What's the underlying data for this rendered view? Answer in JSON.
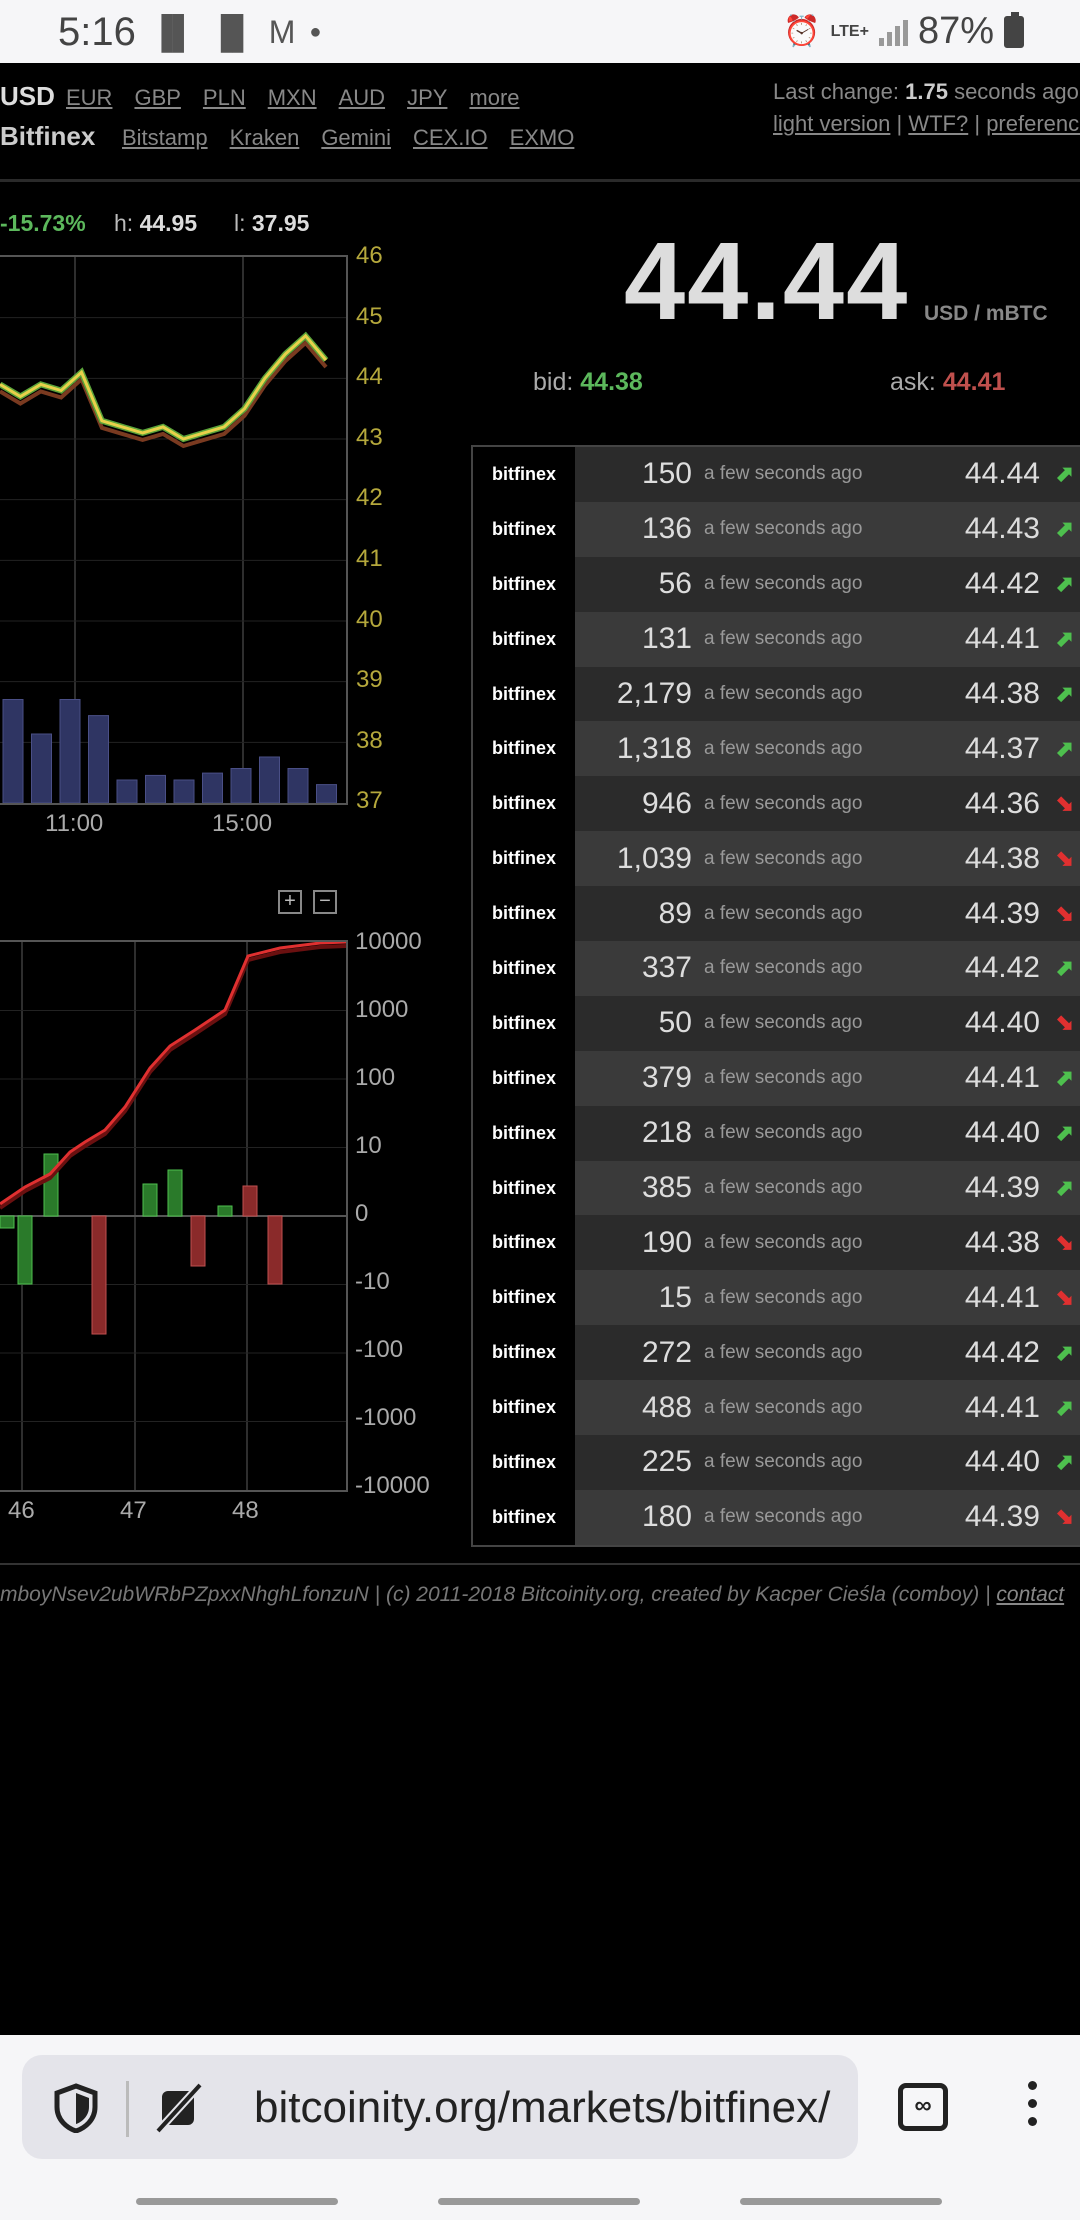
{
  "status_bar": {
    "time": "5:16",
    "network": "LTE+",
    "battery": "87%"
  },
  "header": {
    "active_currency": "USD",
    "currencies": [
      "EUR",
      "GBP",
      "PLN",
      "MXN",
      "AUD",
      "JPY",
      "more"
    ],
    "active_exchange": "Bitfinex",
    "exchanges": [
      "Bitstamp",
      "Kraken",
      "Gemini",
      "CEX.IO",
      "EXMO"
    ],
    "last_change_prefix": "Last change:",
    "last_change_value": "1.75",
    "last_change_suffix": "seconds ago",
    "links": [
      "light version",
      "WTF?",
      "preferences"
    ]
  },
  "stats": {
    "change": "-15.73%",
    "high_label": "h:",
    "high": "44.95",
    "low_label": "l:",
    "low": "37.95"
  },
  "price": {
    "value": "44.44",
    "unit": "USD / mBTC",
    "bid_label": "bid:",
    "bid": "44.38",
    "ask_label": "ask:",
    "ask": "44.41"
  },
  "chart_data": [
    {
      "type": "line",
      "y_ticks": [
        "46",
        "45",
        "44",
        "43",
        "42",
        "41",
        "40",
        "39",
        "38",
        "37"
      ],
      "x_ticks": [
        "11:00",
        "15:00"
      ],
      "ylim": [
        37,
        46
      ],
      "series": [
        {
          "values": [
            43.9,
            43.7,
            43.9,
            43.8,
            44.1,
            43.3,
            43.2,
            43.1,
            43.2,
            43.0,
            43.1,
            43.2,
            43.5,
            44.0,
            44.4,
            44.7,
            44.3
          ]
        }
      ],
      "volume": [
        0.45,
        0.3,
        0.45,
        0.38,
        0.1,
        0.12,
        0.1,
        0.13,
        0.15,
        0.2,
        0.15,
        0.08
      ]
    },
    {
      "type": "line",
      "y_ticks": [
        "10000",
        "1000",
        "100",
        "10",
        "0",
        "-10",
        "-100",
        "-1000",
        "-10000"
      ],
      "x_ticks": [
        "46",
        "47",
        "48"
      ],
      "scale": "symlog"
    }
  ],
  "zoom": {
    "in": "+",
    "out": "−"
  },
  "trades": [
    {
      "exchange": "bitfinex",
      "amount": "150",
      "ago": "a few seconds ago",
      "price": "44.44",
      "dir": "up"
    },
    {
      "exchange": "bitfinex",
      "amount": "136",
      "ago": "a few seconds ago",
      "price": "44.43",
      "dir": "up"
    },
    {
      "exchange": "bitfinex",
      "amount": "56",
      "ago": "a few seconds ago",
      "price": "44.42",
      "dir": "up"
    },
    {
      "exchange": "bitfinex",
      "amount": "131",
      "ago": "a few seconds ago",
      "price": "44.41",
      "dir": "up"
    },
    {
      "exchange": "bitfinex",
      "amount": "2,179",
      "ago": "a few seconds ago",
      "price": "44.38",
      "dir": "up"
    },
    {
      "exchange": "bitfinex",
      "amount": "1,318",
      "ago": "a few seconds ago",
      "price": "44.37",
      "dir": "up"
    },
    {
      "exchange": "bitfinex",
      "amount": "946",
      "ago": "a few seconds ago",
      "price": "44.36",
      "dir": "down"
    },
    {
      "exchange": "bitfinex",
      "amount": "1,039",
      "ago": "a few seconds ago",
      "price": "44.38",
      "dir": "down"
    },
    {
      "exchange": "bitfinex",
      "amount": "89",
      "ago": "a few seconds ago",
      "price": "44.39",
      "dir": "down"
    },
    {
      "exchange": "bitfinex",
      "amount": "337",
      "ago": "a few seconds ago",
      "price": "44.42",
      "dir": "up"
    },
    {
      "exchange": "bitfinex",
      "amount": "50",
      "ago": "a few seconds ago",
      "price": "44.40",
      "dir": "down"
    },
    {
      "exchange": "bitfinex",
      "amount": "379",
      "ago": "a few seconds ago",
      "price": "44.41",
      "dir": "up"
    },
    {
      "exchange": "bitfinex",
      "amount": "218",
      "ago": "a few seconds ago",
      "price": "44.40",
      "dir": "up"
    },
    {
      "exchange": "bitfinex",
      "amount": "385",
      "ago": "a few seconds ago",
      "price": "44.39",
      "dir": "up"
    },
    {
      "exchange": "bitfinex",
      "amount": "190",
      "ago": "a few seconds ago",
      "price": "44.38",
      "dir": "down"
    },
    {
      "exchange": "bitfinex",
      "amount": "15",
      "ago": "a few seconds ago",
      "price": "44.41",
      "dir": "down"
    },
    {
      "exchange": "bitfinex",
      "amount": "272",
      "ago": "a few seconds ago",
      "price": "44.42",
      "dir": "up"
    },
    {
      "exchange": "bitfinex",
      "amount": "488",
      "ago": "a few seconds ago",
      "price": "44.41",
      "dir": "up"
    },
    {
      "exchange": "bitfinex",
      "amount": "225",
      "ago": "a few seconds ago",
      "price": "44.40",
      "dir": "up"
    },
    {
      "exchange": "bitfinex",
      "amount": "180",
      "ago": "a few seconds ago",
      "price": "44.39",
      "dir": "down"
    }
  ],
  "footer": {
    "text": "mboyNsev2ubWRbPZpxxNhghLfonzuN | (c) 2011-2018 Bitcoinity.org, created by Kacper Cieśla (comboy) |",
    "link": "contact"
  },
  "browser": {
    "url": "bitcoinity.org/markets/bitfinex/",
    "tab_icon": "∞"
  },
  "icons": {
    "shield": "shield-icon",
    "mic_off": "mic-off-icon",
    "tabs": "tabs-icon",
    "menu": "menu-dots-icon"
  },
  "colors": {
    "up": "#4ec04e",
    "down": "#e03030",
    "price_line": "#e8d04a",
    "axis_label": "#b5a83c"
  }
}
